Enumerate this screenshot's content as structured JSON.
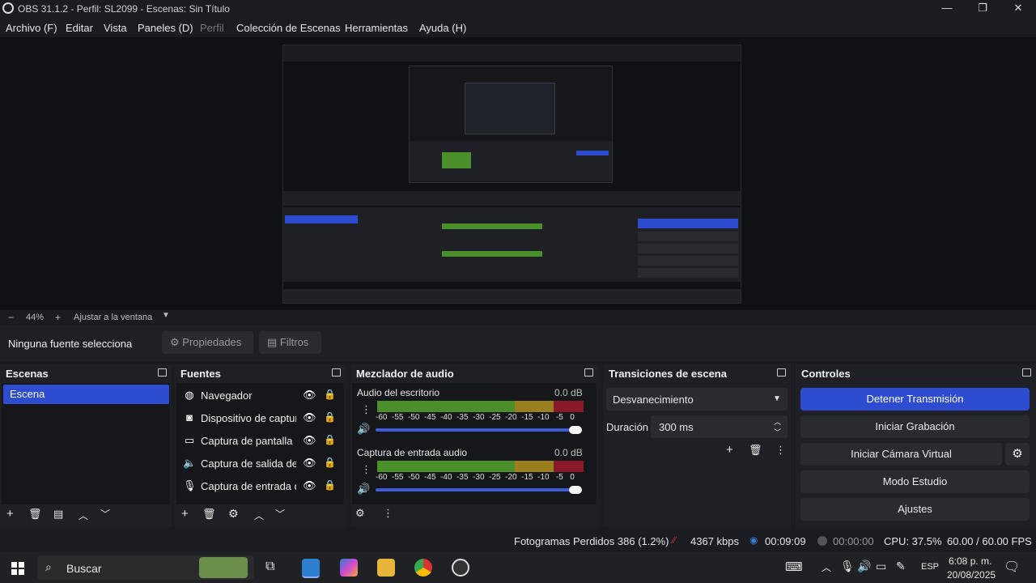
{
  "window": {
    "title": "OBS 31.1.2 - Perfil: SL2099 - Escenas: Sin Título",
    "minimize": "—",
    "maximize": "❐",
    "close": "✕"
  },
  "menu": {
    "items": [
      "Archivo (F)",
      "Editar",
      "Vista",
      "Paneles (D)",
      "Perfil",
      "Colección de Escenas",
      "Herramientas",
      "Ayuda (H)"
    ]
  },
  "zoom": {
    "minus": "−",
    "level": "44%",
    "plus": "+",
    "fit_label": "Ajustar a la ventana"
  },
  "context": {
    "no_source": "Ninguna fuente selecciona",
    "properties": "Propiedades",
    "filters": "Filtros"
  },
  "scenes": {
    "title": "Escenas",
    "items": [
      "Escena"
    ]
  },
  "sources": {
    "title": "Fuentes",
    "items": [
      {
        "label": "Navegador",
        "icon": "globe-icon"
      },
      {
        "label": "Dispositivo de captura de video",
        "icon": "camera-icon"
      },
      {
        "label": "Captura de pantalla",
        "icon": "monitor-icon"
      },
      {
        "label": "Captura de salida de audio",
        "icon": "speaker-icon"
      },
      {
        "label": "Captura de entrada de audio",
        "icon": "microphone-icon"
      }
    ]
  },
  "mixer": {
    "title": "Mezclador de audio",
    "channels": [
      {
        "name": "Audio del escritorio",
        "db": "0.0 dB",
        "volume": 1.0
      },
      {
        "name": "Captura de entrada audio",
        "db": "0.0 dB",
        "volume": 1.0
      }
    ],
    "ticks": [
      "-60",
      "-55",
      "-50",
      "-45",
      "-40",
      "-35",
      "-30",
      "-25",
      "-20",
      "-15",
      "-10",
      "-5",
      "0"
    ]
  },
  "transitions": {
    "title": "Transiciones de escena",
    "selected": "Desvanecimiento",
    "duration_label": "Duración",
    "duration_value": "300 ms"
  },
  "controls": {
    "title": "Controles",
    "stop_stream": "Detener Transmisión",
    "start_recording": "Iniciar Grabación",
    "start_virtual_cam": "Iniciar Cámara Virtual",
    "studio_mode": "Modo Estudio",
    "settings": "Ajustes",
    "accent": "#2d4ccf"
  },
  "status": {
    "dropped_frames": "Fotogramas Perdidos 386 (1.2%)",
    "bitrate": "4367 kbps",
    "stream_time": "00:09:09",
    "rec_time": "00:00:00",
    "cpu": "CPU: 37.5%",
    "fps": "60.00 / 60.00 FPS"
  },
  "taskbar": {
    "search": "Buscar",
    "language": "ESP",
    "time": "6:08 p. m.",
    "date": "20/08/2025"
  }
}
